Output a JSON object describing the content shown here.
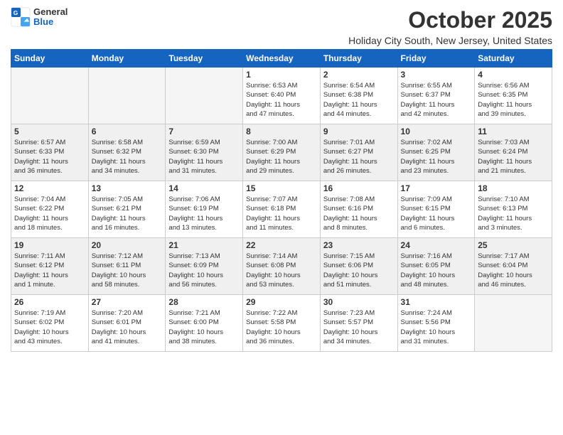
{
  "logo": {
    "general": "General",
    "blue": "Blue"
  },
  "header": {
    "title": "October 2025",
    "subtitle": "Holiday City South, New Jersey, United States"
  },
  "days_of_week": [
    "Sunday",
    "Monday",
    "Tuesday",
    "Wednesday",
    "Thursday",
    "Friday",
    "Saturday"
  ],
  "weeks": [
    [
      {
        "day": "",
        "info": "",
        "empty": true
      },
      {
        "day": "",
        "info": "",
        "empty": true
      },
      {
        "day": "",
        "info": "",
        "empty": true
      },
      {
        "day": "1",
        "info": "Sunrise: 6:53 AM\nSunset: 6:40 PM\nDaylight: 11 hours\nand 47 minutes."
      },
      {
        "day": "2",
        "info": "Sunrise: 6:54 AM\nSunset: 6:38 PM\nDaylight: 11 hours\nand 44 minutes."
      },
      {
        "day": "3",
        "info": "Sunrise: 6:55 AM\nSunset: 6:37 PM\nDaylight: 11 hours\nand 42 minutes."
      },
      {
        "day": "4",
        "info": "Sunrise: 6:56 AM\nSunset: 6:35 PM\nDaylight: 11 hours\nand 39 minutes."
      }
    ],
    [
      {
        "day": "5",
        "info": "Sunrise: 6:57 AM\nSunset: 6:33 PM\nDaylight: 11 hours\nand 36 minutes."
      },
      {
        "day": "6",
        "info": "Sunrise: 6:58 AM\nSunset: 6:32 PM\nDaylight: 11 hours\nand 34 minutes."
      },
      {
        "day": "7",
        "info": "Sunrise: 6:59 AM\nSunset: 6:30 PM\nDaylight: 11 hours\nand 31 minutes."
      },
      {
        "day": "8",
        "info": "Sunrise: 7:00 AM\nSunset: 6:29 PM\nDaylight: 11 hours\nand 29 minutes."
      },
      {
        "day": "9",
        "info": "Sunrise: 7:01 AM\nSunset: 6:27 PM\nDaylight: 11 hours\nand 26 minutes."
      },
      {
        "day": "10",
        "info": "Sunrise: 7:02 AM\nSunset: 6:25 PM\nDaylight: 11 hours\nand 23 minutes."
      },
      {
        "day": "11",
        "info": "Sunrise: 7:03 AM\nSunset: 6:24 PM\nDaylight: 11 hours\nand 21 minutes."
      }
    ],
    [
      {
        "day": "12",
        "info": "Sunrise: 7:04 AM\nSunset: 6:22 PM\nDaylight: 11 hours\nand 18 minutes."
      },
      {
        "day": "13",
        "info": "Sunrise: 7:05 AM\nSunset: 6:21 PM\nDaylight: 11 hours\nand 16 minutes."
      },
      {
        "day": "14",
        "info": "Sunrise: 7:06 AM\nSunset: 6:19 PM\nDaylight: 11 hours\nand 13 minutes."
      },
      {
        "day": "15",
        "info": "Sunrise: 7:07 AM\nSunset: 6:18 PM\nDaylight: 11 hours\nand 11 minutes."
      },
      {
        "day": "16",
        "info": "Sunrise: 7:08 AM\nSunset: 6:16 PM\nDaylight: 11 hours\nand 8 minutes."
      },
      {
        "day": "17",
        "info": "Sunrise: 7:09 AM\nSunset: 6:15 PM\nDaylight: 11 hours\nand 6 minutes."
      },
      {
        "day": "18",
        "info": "Sunrise: 7:10 AM\nSunset: 6:13 PM\nDaylight: 11 hours\nand 3 minutes."
      }
    ],
    [
      {
        "day": "19",
        "info": "Sunrise: 7:11 AM\nSunset: 6:12 PM\nDaylight: 11 hours\nand 1 minute."
      },
      {
        "day": "20",
        "info": "Sunrise: 7:12 AM\nSunset: 6:11 PM\nDaylight: 10 hours\nand 58 minutes."
      },
      {
        "day": "21",
        "info": "Sunrise: 7:13 AM\nSunset: 6:09 PM\nDaylight: 10 hours\nand 56 minutes."
      },
      {
        "day": "22",
        "info": "Sunrise: 7:14 AM\nSunset: 6:08 PM\nDaylight: 10 hours\nand 53 minutes."
      },
      {
        "day": "23",
        "info": "Sunrise: 7:15 AM\nSunset: 6:06 PM\nDaylight: 10 hours\nand 51 minutes."
      },
      {
        "day": "24",
        "info": "Sunrise: 7:16 AM\nSunset: 6:05 PM\nDaylight: 10 hours\nand 48 minutes."
      },
      {
        "day": "25",
        "info": "Sunrise: 7:17 AM\nSunset: 6:04 PM\nDaylight: 10 hours\nand 46 minutes."
      }
    ],
    [
      {
        "day": "26",
        "info": "Sunrise: 7:19 AM\nSunset: 6:02 PM\nDaylight: 10 hours\nand 43 minutes."
      },
      {
        "day": "27",
        "info": "Sunrise: 7:20 AM\nSunset: 6:01 PM\nDaylight: 10 hours\nand 41 minutes."
      },
      {
        "day": "28",
        "info": "Sunrise: 7:21 AM\nSunset: 6:00 PM\nDaylight: 10 hours\nand 38 minutes."
      },
      {
        "day": "29",
        "info": "Sunrise: 7:22 AM\nSunset: 5:58 PM\nDaylight: 10 hours\nand 36 minutes."
      },
      {
        "day": "30",
        "info": "Sunrise: 7:23 AM\nSunset: 5:57 PM\nDaylight: 10 hours\nand 34 minutes."
      },
      {
        "day": "31",
        "info": "Sunrise: 7:24 AM\nSunset: 5:56 PM\nDaylight: 10 hours\nand 31 minutes."
      },
      {
        "day": "",
        "info": "",
        "empty": true
      }
    ]
  ]
}
